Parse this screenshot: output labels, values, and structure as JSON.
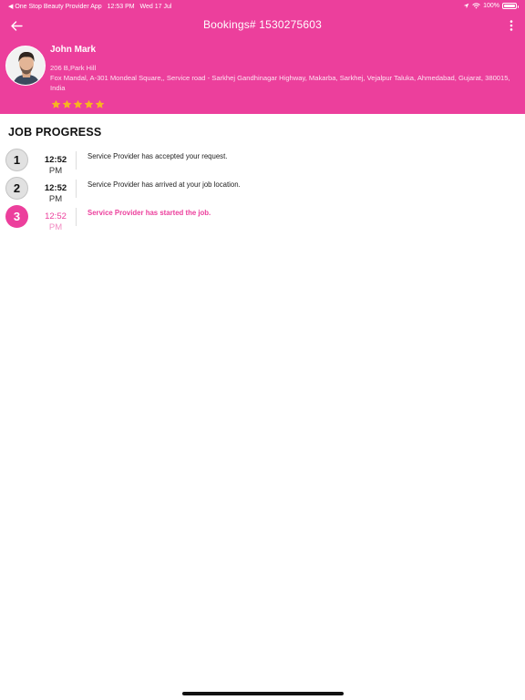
{
  "status_bar": {
    "app_back": "◀ One Stop Beauty Provider App",
    "time": "12:53 PM",
    "date": "Wed 17 Jul",
    "battery": "100%"
  },
  "header": {
    "title": "Bookings# 1530275603",
    "background_color": "#ec3f9c"
  },
  "customer": {
    "name": "John Mark",
    "address_line1": "206 B,Park Hill",
    "address_line2": "Fox Mandal, A-301 Mondeal Square,, Service road - Sarkhej Gandhinagar Highway, Makarba, Sarkhej, Vejalpur Taluka, Ahmedabad, Gujarat, 380015, India",
    "rating": 5,
    "rating_max": 5,
    "star_color": "#f7b520"
  },
  "job_progress": {
    "title": "JOB PROGRESS",
    "steps": [
      {
        "number": "1",
        "time": "12:52",
        "ampm": "PM",
        "text": "Service Provider has accepted your request."
      },
      {
        "number": "2",
        "time": "12:52",
        "ampm": "PM",
        "text": "Service Provider has arrived at your job location."
      },
      {
        "number": "3",
        "time": "12:52",
        "ampm": "PM",
        "text": "Service Provider has started the job."
      }
    ]
  },
  "icons": {
    "back": "arrow-left-icon",
    "more": "more-vertical-icon",
    "location": "location-arrow-icon",
    "wifi": "wifi-icon"
  }
}
